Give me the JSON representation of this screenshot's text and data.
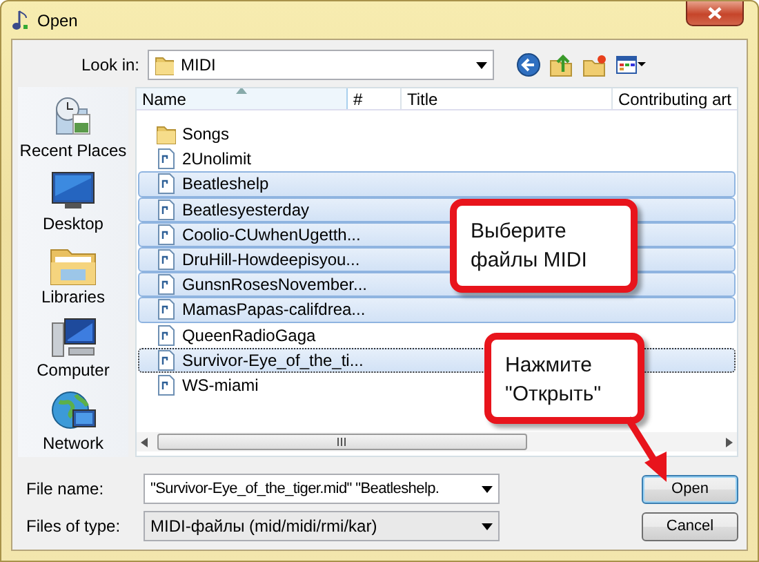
{
  "window": {
    "title": "Open"
  },
  "look_in": {
    "label": "Look in:",
    "value": "MIDI"
  },
  "places": [
    {
      "label": "Recent Places",
      "kind": "recent"
    },
    {
      "label": "Desktop",
      "kind": "desktop"
    },
    {
      "label": "Libraries",
      "kind": "libraries"
    },
    {
      "label": "Computer",
      "kind": "computer"
    },
    {
      "label": "Network",
      "kind": "network"
    }
  ],
  "table": {
    "columns": [
      "Name",
      "#",
      "Title",
      "Contributing art"
    ],
    "rows": [
      {
        "name": "Songs",
        "kind": "folder",
        "selected": false,
        "focused": false
      },
      {
        "name": "2Unolimit",
        "kind": "file",
        "selected": false,
        "focused": false
      },
      {
        "name": "Beatleshelp",
        "kind": "file",
        "selected": true,
        "focused": false
      },
      {
        "name": "Beatlesyesterday",
        "kind": "file",
        "selected": true,
        "focused": false
      },
      {
        "name": "Coolio-CUwhenUgetth...",
        "kind": "file",
        "selected": true,
        "focused": false
      },
      {
        "name": "DruHill-Howdeepisyou...",
        "kind": "file",
        "selected": true,
        "focused": false
      },
      {
        "name": "GunsnRosesNovember...",
        "kind": "file",
        "selected": true,
        "focused": false
      },
      {
        "name": "MamasPapas-califdrea...",
        "kind": "file",
        "selected": true,
        "focused": false
      },
      {
        "name": "QueenRadioGaga",
        "kind": "file",
        "selected": false,
        "focused": false
      },
      {
        "name": "Survivor-Eye_of_the_ti...",
        "kind": "file",
        "selected": true,
        "focused": true
      },
      {
        "name": "WS-miami",
        "kind": "file",
        "selected": false,
        "focused": false
      }
    ]
  },
  "file_name": {
    "label": "File name:",
    "value": "\"Survivor-Eye_of_the_tiger.mid\" \"Beatleshelp."
  },
  "file_type": {
    "label": "Files of type:",
    "value": "MIDI-файлы (mid/midi/rmi/kar)"
  },
  "buttons": [
    {
      "label": "Open",
      "default": true
    },
    {
      "label": "Cancel",
      "default": false
    }
  ],
  "callouts": [
    {
      "text": "Выберите\nфайлы MIDI",
      "kind": "plain"
    },
    {
      "text": "Нажмите\n\"Открыть\"",
      "kind": "pointer"
    }
  ]
}
